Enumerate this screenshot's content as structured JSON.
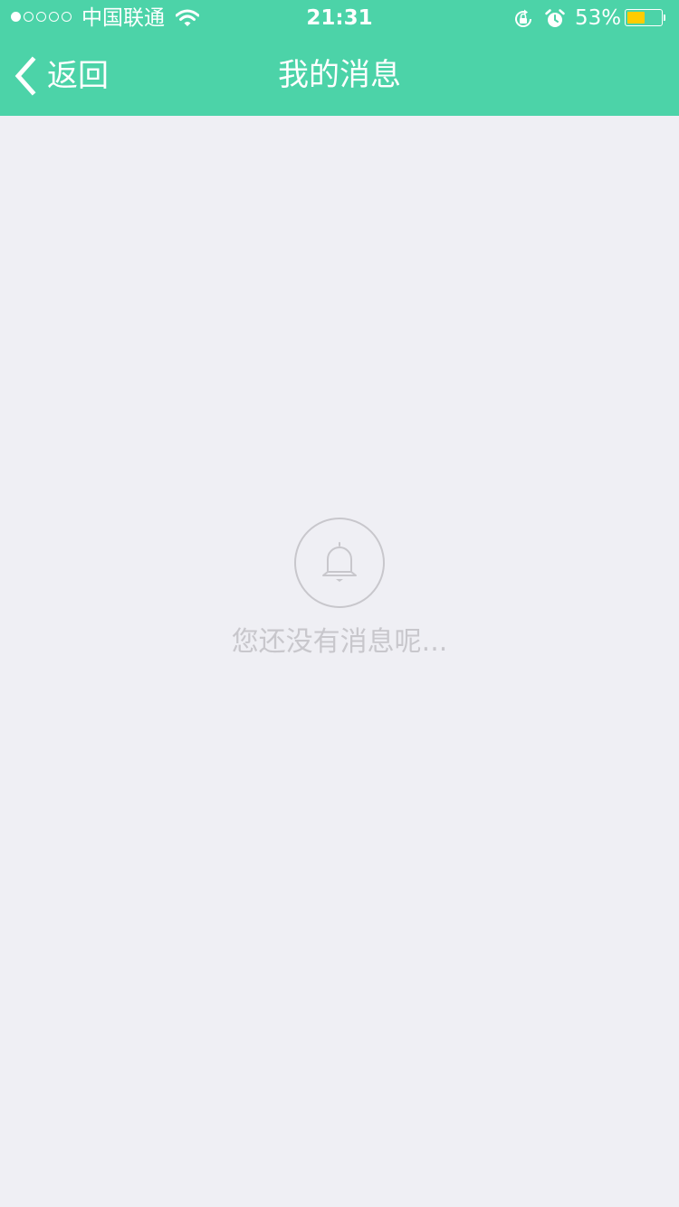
{
  "status_bar": {
    "signal_dots_filled": 1,
    "signal_dots_total": 5,
    "carrier": "中国联通",
    "time": "21:31",
    "battery_percent_label": "53%",
    "battery_level": 0.53,
    "battery_color": "#ffcc00",
    "icons": [
      "wifi-icon",
      "rotation-lock-icon",
      "alarm-icon",
      "battery-icon"
    ]
  },
  "nav": {
    "back_label": "返回",
    "title": "我的消息",
    "background_color": "#4cd3a8"
  },
  "empty_state": {
    "icon": "bell-icon",
    "message": "您还没有消息呢..."
  }
}
